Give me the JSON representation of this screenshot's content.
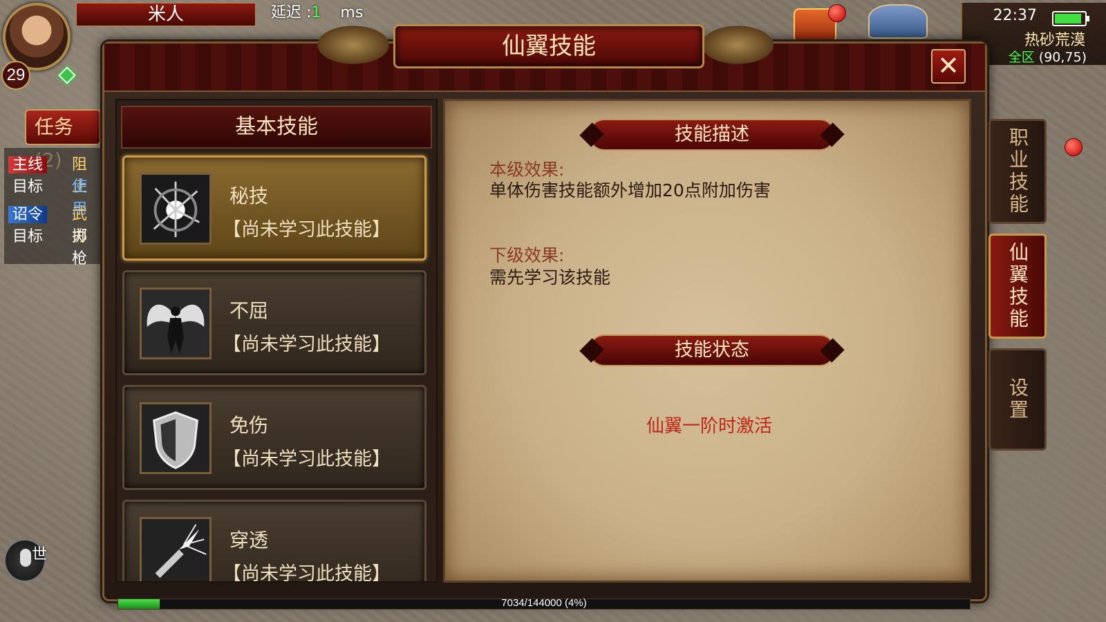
{
  "hud": {
    "player_name": "米人",
    "level": "29",
    "latency_label": "延迟 :",
    "latency_value": "1",
    "latency_unit": "ms",
    "time": "22:37",
    "map_name": "热砂荒漠",
    "zone": "全区",
    "coords": "(90,75)",
    "task_tab": "任务(2)",
    "tasks": [
      {
        "tag": "主线",
        "tag_color": "red",
        "side": "阻止"
      },
      {
        "tag": "目标",
        "tag_color": "none",
        "side": "使用"
      },
      {
        "tag": "诏令",
        "tag_color": "blue",
        "side": "武力"
      },
      {
        "tag": "目标",
        "tag_color": "none",
        "side": "掷枪"
      }
    ],
    "voice_label": "世",
    "exp_text": "7034/144000 (4%)",
    "exp_fraction": 0.049
  },
  "dialog": {
    "title": "仙翼技能",
    "close_symbol": "✕",
    "left_header": "基本技能",
    "skills": [
      {
        "name": "秘技",
        "status": "【尚未学习此技能】",
        "icon": "burst-icon",
        "selected": true
      },
      {
        "name": "不屈",
        "status": "【尚未学习此技能】",
        "icon": "winged-warrior-icon",
        "selected": false
      },
      {
        "name": "免伤",
        "status": "【尚未学习此技能】",
        "icon": "shield-icon",
        "selected": false
      },
      {
        "name": "穿透",
        "status": "【尚未学习此技能】",
        "icon": "pierce-icon",
        "selected": false
      }
    ],
    "desc_title": "技能描述",
    "current_label": "本级效果:",
    "current_text": "单体伤害技能额外增加20点附加伤害",
    "next_label": "下级效果:",
    "next_text": "需先学习该技能",
    "status_title": "技能状态",
    "status_text": "仙翼一阶时激活"
  },
  "side_tabs": [
    {
      "label": "职业技能",
      "active": false
    },
    {
      "label": "仙翼技能",
      "active": true
    },
    {
      "label": "设置",
      "active": false
    }
  ],
  "colors": {
    "accent_red": "#8a1a12",
    "gold_border": "#c99a4a",
    "status_red": "#c0251a",
    "exp_green": "#4ce04c"
  }
}
